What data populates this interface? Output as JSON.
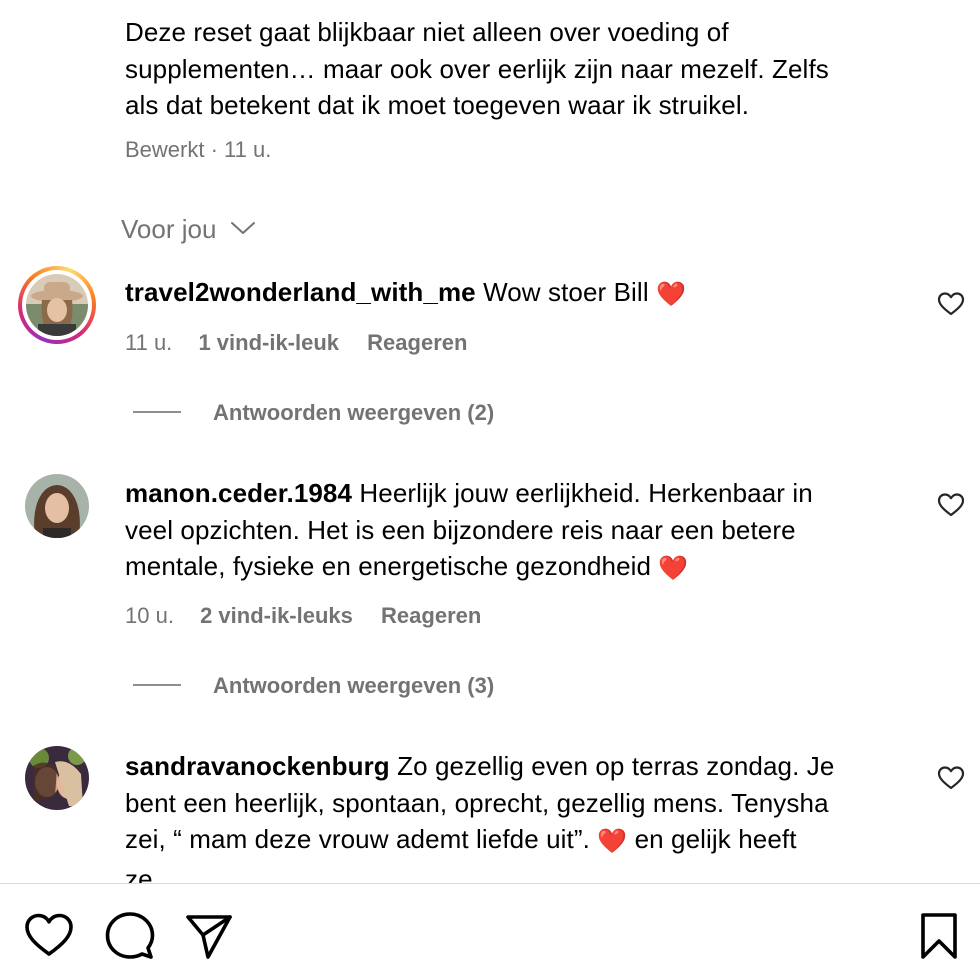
{
  "caption": {
    "text": "Deze reset gaat blijkbaar niet alleen over voeding of supplementen… maar ook over eerlijk zijn naar mezelf. Zelfs als dat betekent dat ik moet toegeven waar ik struikel.",
    "line1": "Deze reset gaat blijkbaar niet alleen over voeding of",
    "line2": "supplementen… maar ook over eerlijk zijn naar mezelf. Zelfs",
    "line3": "als dat betekent dat ik moet toegeven waar ik struikel.",
    "meta": "Bewerkt · 11 u."
  },
  "filter": {
    "label": "Voor jou"
  },
  "comments": [
    {
      "username": "travel2wonderland_with_me",
      "text": "Wow stoer Bill",
      "emoji": "❤️",
      "time": "11 u.",
      "likes": "1 vind-ik-leuk",
      "reply": "Reageren",
      "view_replies": "Antwoorden weergeven (2)",
      "has_story_ring": true
    },
    {
      "username": "manon.ceder.1984",
      "text": "Heerlijk jouw eerlijkheid. Herkenbaar in veel opzichten. Het is een bijzondere reis naar een betere mentale, fysieke en energetische gezondheid",
      "line1": "Heerlijk jouw eerlijkheid. Herkenbaar in",
      "line2": "veel opzichten. Het is een bijzondere reis naar een betere",
      "line3": "mentale, fysieke en energetische gezondheid",
      "emoji": "❤️",
      "time": "10 u.",
      "likes": "2 vind-ik-leuks",
      "reply": "Reageren",
      "view_replies": "Antwoorden weergeven (3)"
    },
    {
      "username": "sandravanockenburg",
      "text": "Zo gezellig even op terras zondag. Je bent een heerlijk, spontaan, oprecht, gezellig mens. Tenysha zei, “ mam deze vrouw ademt liefde uit”. ❤️ en gelijk heeft ze.",
      "line1": "Zo gezellig even op terras zondag. Je",
      "line2": "bent een heerlijk, spontaan, oprecht, gezellig mens. Tenysha",
      "line3a": "zei, “ mam deze vrouw ademt liefde uit”.",
      "emoji": "❤️",
      "line3b": "en gelijk heeft",
      "line4": "ze."
    }
  ],
  "colors": {
    "meta_gray": "#737373",
    "heart_red": "#e0242b",
    "ring_gradient": [
      "#feda75",
      "#fa7e1e",
      "#d62976",
      "#962fbf"
    ]
  },
  "action_bar": {
    "icons": [
      "heart-icon",
      "comment-icon",
      "share-icon",
      "bookmark-icon"
    ]
  }
}
